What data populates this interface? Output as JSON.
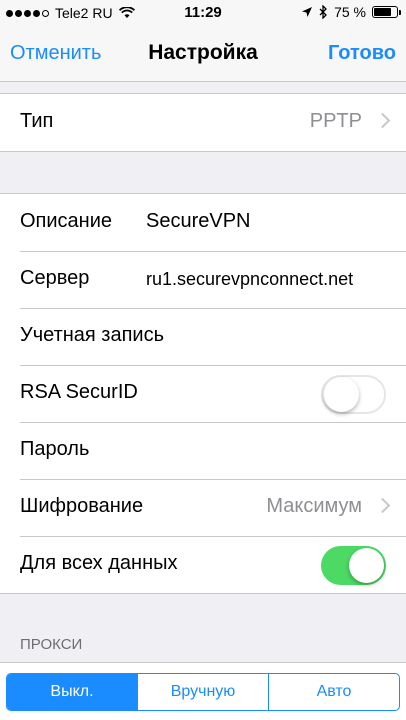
{
  "status_bar": {
    "carrier": "Tele2 RU",
    "time": "11:29",
    "battery": "75 %",
    "signal_bars_filled": 4,
    "signal_bars_total": 5,
    "battery_level": 0.75
  },
  "nav": {
    "cancel_label": "Отменить",
    "title": "Настройка",
    "done_label": "Готово"
  },
  "type_row": {
    "label": "Тип",
    "value": "PPTP"
  },
  "settings": {
    "description_label": "Описание",
    "description_value": "SecureVPN",
    "server_label": "Сервер",
    "server_value": "ru1.securevpnconnect.net",
    "account_label": "Учетная запись",
    "rsa_label": "RSA SecurID",
    "rsa_enabled": false,
    "password_label": "Пароль",
    "encryption_label": "Шифрование",
    "encryption_value": "Максимум",
    "all_data_label": "Для всех данных",
    "all_data_enabled": true
  },
  "proxy": {
    "header": "ПРОКСИ",
    "options": [
      "Выкл.",
      "Вручную",
      "Авто"
    ],
    "selected": "Выкл."
  },
  "colors": {
    "accent": "#1a8cff",
    "toggle_on": "#4cd964",
    "background": "#efeff4"
  }
}
